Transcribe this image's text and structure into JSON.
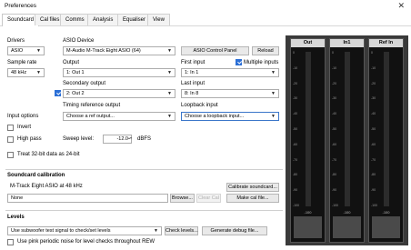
{
  "window": {
    "title": "Preferences",
    "close_glyph": "✕"
  },
  "tabs": [
    {
      "label": "Soundcard",
      "active": true
    },
    {
      "label": "Cal files"
    },
    {
      "label": "Comms"
    },
    {
      "label": "Analysis"
    },
    {
      "label": "Equaliser"
    },
    {
      "label": "View"
    }
  ],
  "drivers": {
    "label": "Drivers",
    "value": "ASIO"
  },
  "sample_rate": {
    "label": "Sample rate",
    "value": "48 kHz"
  },
  "asio_device": {
    "label": "ASIO Device",
    "value": "M-Audio M-Track Eight ASIO (64)"
  },
  "asio_control_panel_label": "ASIO Control Panel",
  "reload_label": "Reload",
  "output": {
    "label": "Output",
    "value": "1: Out 1"
  },
  "first_input": {
    "label": "First input",
    "value": "1: In 1"
  },
  "multiple_inputs": {
    "label": "Multiple inputs",
    "checked": true
  },
  "secondary_output": {
    "label": "Secondary output",
    "value": "2: Out 2",
    "checked": true
  },
  "last_input": {
    "label": "Last input",
    "value": "8: In 8"
  },
  "timing_ref_output": {
    "label": "Timing reference output",
    "value": "Choose a ref output..."
  },
  "loopback_input": {
    "label": "Loopback input",
    "value": "Choose a loopback input..."
  },
  "input_options": {
    "label": "Input options",
    "invert": {
      "label": "Invert",
      "checked": false
    },
    "high_pass": {
      "label": "High pass",
      "checked": false
    },
    "treat_32bit": {
      "label": "Treat 32-bit data as 24-bit",
      "checked": false
    }
  },
  "sweep_level": {
    "label": "Sweep level:",
    "value": "-12.0",
    "unit": "dBFS"
  },
  "calibration": {
    "section_label": "Soundcard calibration",
    "device_text": "M-Track Eight ASIO at 48 kHz",
    "calibrate_label": "Calibrate soundcard...",
    "file_value": "None",
    "browse_label": "Browse...",
    "clear_cal_label": "Clear Cal",
    "make_cal_label": "Make cal file..."
  },
  "levels": {
    "section_label": "Levels",
    "test_signal_value": "Use subwoofer test signal to check/set levels",
    "check_levels_label": "Check levels...",
    "debug_file_label": "Generate debug file...",
    "pink_noise": {
      "label": "Use pink periodic noise for level checks throughout REW",
      "checked": false
    }
  },
  "meters": [
    {
      "name": "Out",
      "value": "-100",
      "unit": "dBFS",
      "level": 0.0
    },
    {
      "name": "In1",
      "value": "-100",
      "unit": "dBFS",
      "level": 0.0
    },
    {
      "name": "Ref In",
      "value": "-100",
      "unit": "dBFS",
      "level": 0.0
    }
  ],
  "meter_ticks": [
    "0",
    "-10",
    "-20",
    "-30",
    "-40",
    "-50",
    "-60",
    "-70",
    "-80",
    "-90",
    "-100"
  ],
  "colors": {
    "accent": "#2b6fd6",
    "meter_fill": "#9ca14f",
    "meter_bg": "#3a3a3a"
  },
  "icons": {
    "dropdown": "chevron-down-icon",
    "close": "close-icon",
    "checkbox_checked": "checkmark-icon"
  }
}
